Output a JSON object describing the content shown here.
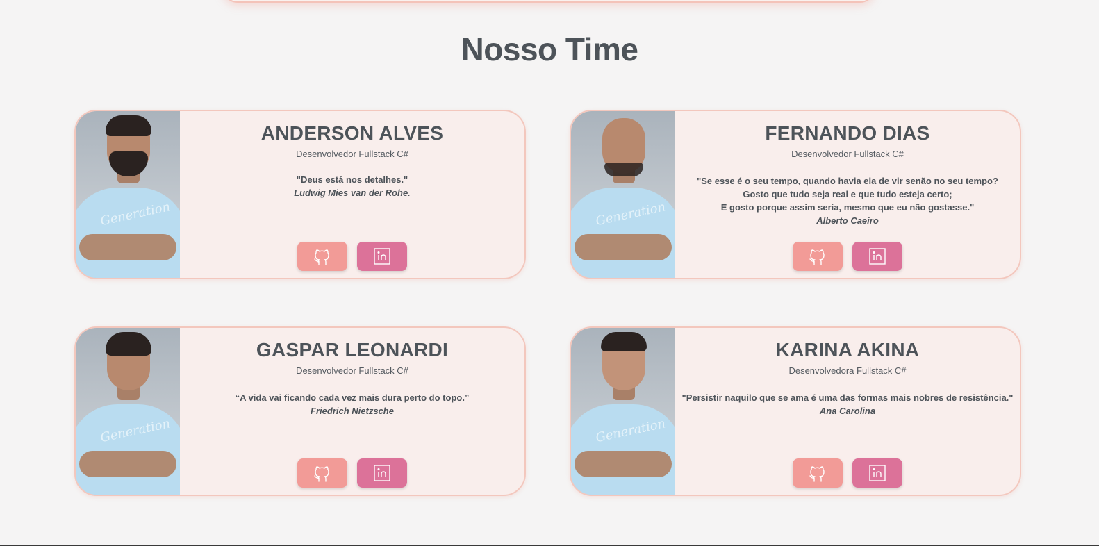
{
  "section": {
    "title": "Nosso Time"
  },
  "members": [
    {
      "name": "ANDERSON ALVES",
      "role": "Desenvolvedor Fullstack C#",
      "quote_lines": [
        "\"Deus está nos detalhes.\""
      ],
      "author": "Ludwig Mies van der Rohe."
    },
    {
      "name": "FERNANDO DIAS",
      "role": "Desenvolvedor Fullstack C#",
      "quote_lines": [
        "\"Se esse é o seu tempo, quando havia ela de vir senão no seu tempo?",
        "Gosto que tudo seja real e que tudo esteja certo;",
        "E gosto porque assim seria, mesmo que eu não gostasse.\""
      ],
      "author": "Alberto Caeiro"
    },
    {
      "name": "GASPAR LEONARDI",
      "role": "Desenvolvedor Fullstack C#",
      "quote_lines": [
        "“A vida vai ficando cada vez mais dura perto do topo.”"
      ],
      "author": "Friedrich Nietzsche"
    },
    {
      "name": "KARINA AKINA",
      "role": "Desenvolvedora Fullstack C#",
      "quote_lines": [
        "\"Persistir naquilo que se ama é uma das formas mais nobres de resistência.\""
      ],
      "author": "Ana Carolina"
    }
  ],
  "buttons": {
    "github_icon": "github-icon",
    "linkedin_icon": "linkedin-icon"
  },
  "colors": {
    "background": "#f5f4f4",
    "card_background": "#f9eeec",
    "card_border": "#f3c7bd",
    "github_button": "#f29b97",
    "linkedin_button": "#dc7299",
    "text": "#4d5359"
  }
}
